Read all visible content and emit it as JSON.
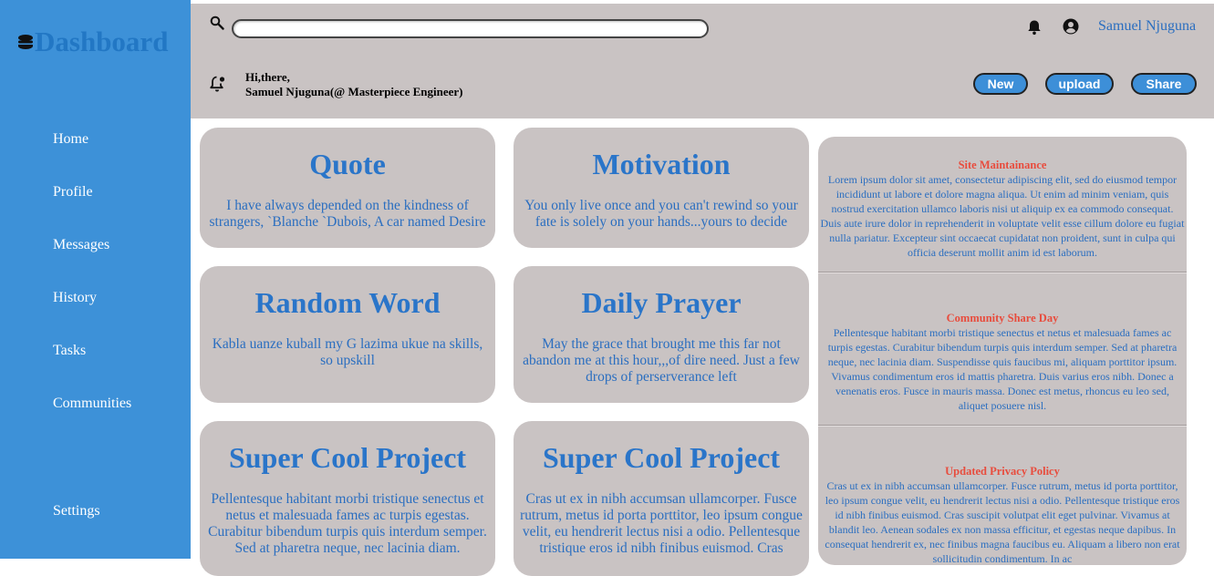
{
  "brand": {
    "title": "Dashboard",
    "icon": "stacked-layers-icon",
    "color": "#2277c4"
  },
  "sidebar": {
    "background": "#3d91d8",
    "items": [
      {
        "label": "Home"
      },
      {
        "label": "Profile"
      },
      {
        "label": "Messages"
      },
      {
        "label": "History"
      },
      {
        "label": "Tasks"
      },
      {
        "label": "Communities"
      }
    ],
    "settings_label": "Settings"
  },
  "header": {
    "background": "#c9c3c3",
    "search": {
      "value": "",
      "placeholder": ""
    },
    "user_name": "Samuel Njuguna",
    "greeting_line1": "Hi,there,",
    "greeting_line2": "Samuel Njuguna(@ Masterpiece Engineer)",
    "buttons": {
      "new": "New",
      "upload": "upload",
      "share": "Share"
    }
  },
  "cards": [
    {
      "title": "Quote",
      "body": "I have always depended on the kindness of strangers, `Blanche `Dubois, A car named Desire"
    },
    {
      "title": "Motivation",
      "body": "You only live once and you can't rewind so your fate is solely on your hands...yours to decide"
    },
    {
      "title": "Random Word",
      "body": "Kabla uanze kuball my G lazima ukue na skills, so upskill"
    },
    {
      "title": "Daily Prayer",
      "body": "May the grace that brought me this far not abandon me at this hour,,,of dire need. Just a few drops of perserverance left"
    },
    {
      "title": "Super Cool Project",
      "body": "Pellentesque habitant morbi tristique senectus et netus et malesuada fames ac turpis egestas. Curabitur bibendum turpis quis interdum semper. Sed at pharetra neque, nec lacinia diam."
    },
    {
      "title": "Super Cool Project",
      "body": "Cras ut ex in nibh accumsan ullamcorper. Fusce rutrum, metus id porta porttitor, leo ipsum congue velit, eu hendrerit lectus nisi a odio. Pellentesque tristique eros id nibh finibus euismod. Cras"
    }
  ],
  "announcements": [
    {
      "title": "Site Maintainance",
      "body": "Lorem ipsum dolor sit amet, consectetur adipiscing elit, sed do eiusmod tempor incididunt ut labore et dolore magna aliqua. Ut enim ad minim veniam, quis nostrud exercitation ullamco laboris nisi ut aliquip ex ea commodo consequat. Duis aute irure dolor in reprehenderit in voluptate velit esse cillum dolore eu fugiat nulla pariatur. Excepteur sint occaecat cupidatat non proident, sunt in culpa qui officia deserunt mollit anim id est laborum."
    },
    {
      "title": "Community Share Day",
      "body": "Pellentesque habitant morbi tristique senectus et netus et malesuada fames ac turpis egestas. Curabitur bibendum turpis quis interdum semper. Sed at pharetra neque, nec lacinia diam. Suspendisse quis faucibus mi, aliquam porttitor ipsum. Vivamus condimentum eros id mattis pharetra. Duis varius eros nibh. Donec a venenatis eros. Fusce in mauris massa. Donec est metus, rhoncus eu leo sed, aliquet posuere nisl."
    },
    {
      "title": "Updated Privacy Policy",
      "body": "Cras ut ex in nibh accumsan ullamcorper. Fusce rutrum, metus id porta porttitor, leo ipsum congue velit, eu hendrerit lectus nisi a odio. Pellentesque tristique eros id nibh finibus euismod. Cras suscipit volutpat elit eget pulvinar. Vivamus at blandit leo. Aenean sodales ex non massa efficitur, et egestas neque dapibus. In consequat hendrerit ex, nec finibus magna faucibus eu. Aliquam a libero non erat sollicitudin condimentum. In ac"
    }
  ],
  "colors": {
    "accent": "#3d8fd8",
    "card_bg": "#c9c3c3",
    "title_blue": "#2a75c9",
    "announcement_red": "#e84c3d"
  }
}
